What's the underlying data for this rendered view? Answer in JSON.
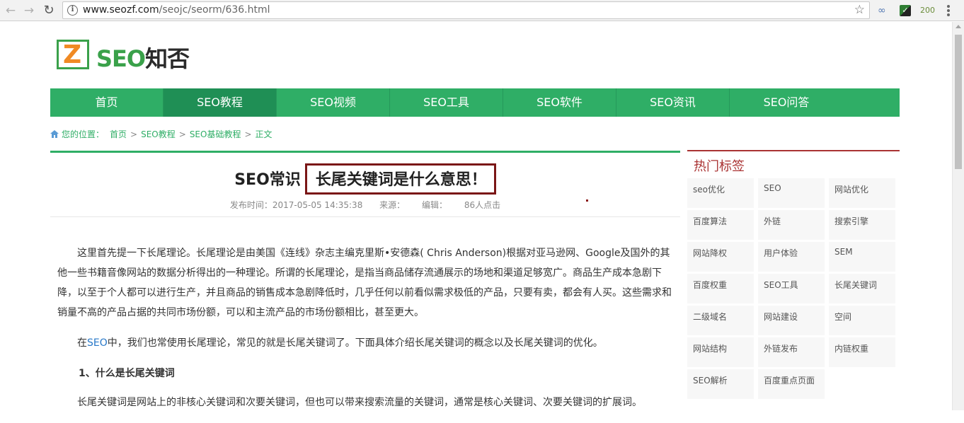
{
  "browser": {
    "url_host": "www.seozf.com",
    "url_path": "/seojc/seorm/636.html",
    "ext_badge": "200"
  },
  "logo": {
    "mark": "Z",
    "seo": "SEO",
    "cn": "知否"
  },
  "nav": {
    "items": [
      {
        "label": "首页"
      },
      {
        "label": "SEO教程"
      },
      {
        "label": "SEO视频"
      },
      {
        "label": "SEO工具"
      },
      {
        "label": "SEO软件"
      },
      {
        "label": "SEO资讯"
      },
      {
        "label": "SEO问答"
      }
    ],
    "active_index": 1
  },
  "breadcrumb": {
    "lead": "您的位置：",
    "items": [
      "首页",
      "SEO教程",
      "SEO基础教程",
      "正文"
    ],
    "separator": ">"
  },
  "article": {
    "title_prefix": "SEO常识",
    "title_highlight": "长尾关键词是什么意思！",
    "meta_time": "发布时间：2017-05-05 14:35:38",
    "meta_source": "来源：",
    "meta_editor": "编辑：",
    "meta_clicks": "86人点击",
    "para1": "这里首先提一下长尾理论。长尾理论是由美国《连线》杂志主编克里斯•安德森( Chris Anderson)根据对亚马逊网、Google及国外的其他一些书籍音像网站的数据分析得出的一种理论。所谓的长尾理论，是指当商品储存流通展示的场地和渠道足够宽广。商品生产成本急剧下降，以至于个人都可以进行生产，并且商品的销售成本急剧降低时，几乎任何以前看似需求极低的产品，只要有卖，都会有人买。这些需求和销量不高的产品占据的共同市场份额，可以和主流产品的市场份额相比，甚至更大。",
    "para2_pre": "在",
    "para2_link": "SEO",
    "para2_post": "中，我们也常使用长尾理论，常见的就是长尾关键词了。下面具体介绍长尾关键词的概念以及长尾关键词的优化。",
    "heading1": "1、什么是长尾关键词",
    "para3": "长尾关键词是网站上的非核心关键词和次要关键词，但也可以带来搜索流量的关键词，通常是核心关键词、次要关键词的扩展词。"
  },
  "sidebar": {
    "title": "热门标签",
    "tags": [
      "seo优化",
      "SEO",
      "网站优化",
      "百度算法",
      "外链",
      "搜索引擎",
      "网站降权",
      "用户体验",
      "SEM",
      "百度权重",
      "SEO工具",
      "长尾关键词",
      "二级域名",
      "网站建设",
      "空间",
      "网站结构",
      "外链发布",
      "内链权重",
      "SEO解析",
      "百度重点页面"
    ]
  },
  "colors": {
    "brand_green": "#2fae66",
    "highlight_border": "#7a1616",
    "sidebar_accent": "#a33"
  }
}
